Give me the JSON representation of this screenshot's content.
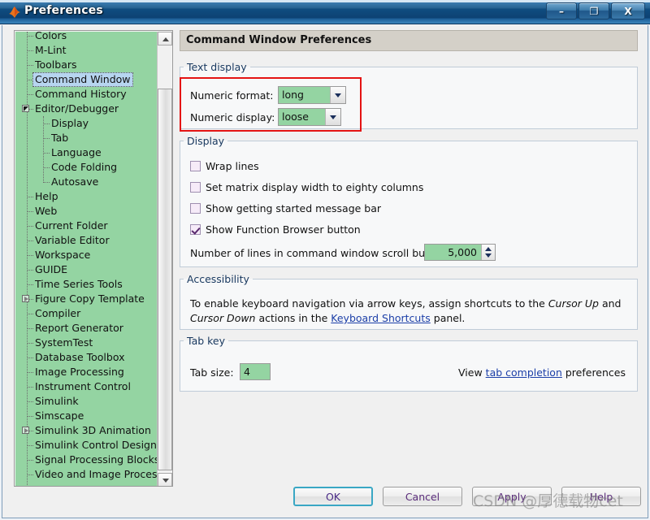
{
  "window": {
    "title": "Preferences",
    "icon": "matlab-membrane-icon",
    "controls": {
      "minimize": "–",
      "maximize": "❐",
      "close": "X"
    }
  },
  "sidebar": {
    "scrollbar": {
      "up": "scroll-up-arrow",
      "down": "scroll-down-arrow"
    },
    "items": [
      {
        "label": "Colors",
        "indent": 0,
        "toggle": "none",
        "selected": false,
        "clipped": true
      },
      {
        "label": "M-Lint",
        "indent": 0,
        "toggle": "none",
        "selected": false
      },
      {
        "label": "Toolbars",
        "indent": 0,
        "toggle": "none",
        "selected": false
      },
      {
        "label": "Command Window",
        "indent": 0,
        "toggle": "none",
        "selected": true
      },
      {
        "label": "Command History",
        "indent": 0,
        "toggle": "none",
        "selected": false
      },
      {
        "label": "Editor/Debugger",
        "indent": 0,
        "toggle": "open",
        "selected": false
      },
      {
        "label": "Display",
        "indent": 1,
        "toggle": "none",
        "selected": false
      },
      {
        "label": "Tab",
        "indent": 1,
        "toggle": "none",
        "selected": false
      },
      {
        "label": "Language",
        "indent": 1,
        "toggle": "none",
        "selected": false
      },
      {
        "label": "Code Folding",
        "indent": 1,
        "toggle": "none",
        "selected": false
      },
      {
        "label": "Autosave",
        "indent": 1,
        "toggle": "none",
        "selected": false
      },
      {
        "label": "Help",
        "indent": 0,
        "toggle": "none",
        "selected": false
      },
      {
        "label": "Web",
        "indent": 0,
        "toggle": "none",
        "selected": false
      },
      {
        "label": "Current Folder",
        "indent": 0,
        "toggle": "none",
        "selected": false
      },
      {
        "label": "Variable Editor",
        "indent": 0,
        "toggle": "none",
        "selected": false
      },
      {
        "label": "Workspace",
        "indent": 0,
        "toggle": "none",
        "selected": false
      },
      {
        "label": "GUIDE",
        "indent": 0,
        "toggle": "none",
        "selected": false
      },
      {
        "label": "Time Series Tools",
        "indent": 0,
        "toggle": "none",
        "selected": false
      },
      {
        "label": "Figure Copy Template",
        "indent": 0,
        "toggle": "closed",
        "selected": false
      },
      {
        "label": "Compiler",
        "indent": 0,
        "toggle": "none",
        "selected": false
      },
      {
        "label": "Report Generator",
        "indent": 0,
        "toggle": "none",
        "selected": false
      },
      {
        "label": "SystemTest",
        "indent": 0,
        "toggle": "none",
        "selected": false
      },
      {
        "label": "Database Toolbox",
        "indent": 0,
        "toggle": "none",
        "selected": false
      },
      {
        "label": "Image Processing",
        "indent": 0,
        "toggle": "none",
        "selected": false
      },
      {
        "label": "Instrument Control",
        "indent": 0,
        "toggle": "none",
        "selected": false
      },
      {
        "label": "Simulink",
        "indent": 0,
        "toggle": "none",
        "selected": false
      },
      {
        "label": "Simscape",
        "indent": 0,
        "toggle": "none",
        "selected": false
      },
      {
        "label": "Simulink 3D Animation",
        "indent": 0,
        "toggle": "closed",
        "selected": false
      },
      {
        "label": "Simulink Control Design",
        "indent": 0,
        "toggle": "none",
        "selected": false
      },
      {
        "label": "Signal Processing Blockset",
        "indent": 0,
        "toggle": "none",
        "selected": false
      },
      {
        "label": "Video and Image Processing",
        "indent": 0,
        "toggle": "none",
        "selected": false
      }
    ]
  },
  "main": {
    "header": "Command Window Preferences",
    "text_display": {
      "legend": "Text display",
      "numeric_format_label": "Numeric format:",
      "numeric_format_value": "long",
      "numeric_display_label": "Numeric display:",
      "numeric_display_value": "loose"
    },
    "display": {
      "legend": "Display",
      "checkboxes": [
        {
          "label": "Wrap lines",
          "checked": false
        },
        {
          "label": "Set matrix display width to eighty columns",
          "checked": false
        },
        {
          "label": "Show getting started message bar",
          "checked": false
        },
        {
          "label": "Show Function Browser button",
          "checked": true
        }
      ],
      "buffer_label": "Number of lines in command window scroll buffer:",
      "buffer_value": "5,000"
    },
    "accessibility": {
      "legend": "Accessibility",
      "text_part1": "To enable keyboard navigation via arrow keys, assign shortcuts to the ",
      "cursor_up": "Cursor Up",
      "text_and": " and ",
      "cursor_down": "Cursor Down",
      "text_part2": " actions in the ",
      "link": "Keyboard Shortcuts",
      "text_part3": " panel."
    },
    "tab_key": {
      "legend": "Tab key",
      "tab_size_label": "Tab size:",
      "tab_size_value": "4",
      "view_prefix": "View ",
      "view_link": "tab completion",
      "view_suffix": " preferences"
    }
  },
  "buttons": {
    "ok": "OK",
    "cancel": "Cancel",
    "apply": "Apply",
    "help": "Help"
  },
  "watermark": "CSDN @厚德载物cet",
  "colors": {
    "field_green": "#94d4a2",
    "selection_blue": "#b7d5f0",
    "annotation_red": "#e41313",
    "legend_blue": "#17375e",
    "link_blue": "#1c3fa8"
  }
}
